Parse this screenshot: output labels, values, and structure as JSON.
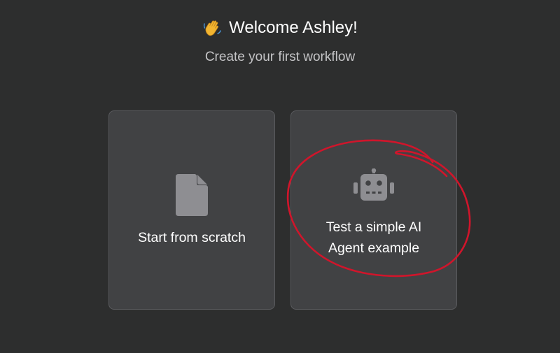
{
  "header": {
    "welcome_text": "Welcome Ashley!",
    "wave_icon": "waving-hand-emoji",
    "subtitle": "Create your first workflow"
  },
  "cards": [
    {
      "label": "Start from scratch",
      "icon": "document-icon"
    },
    {
      "label": "Test a simple AI Agent example",
      "icon": "robot-icon"
    }
  ],
  "colors": {
    "background": "#2d2e2e",
    "card_background": "#414244",
    "card_border": "#5a5b5e",
    "icon_color": "#8e8e92",
    "annotation_color": "#d0152b"
  }
}
